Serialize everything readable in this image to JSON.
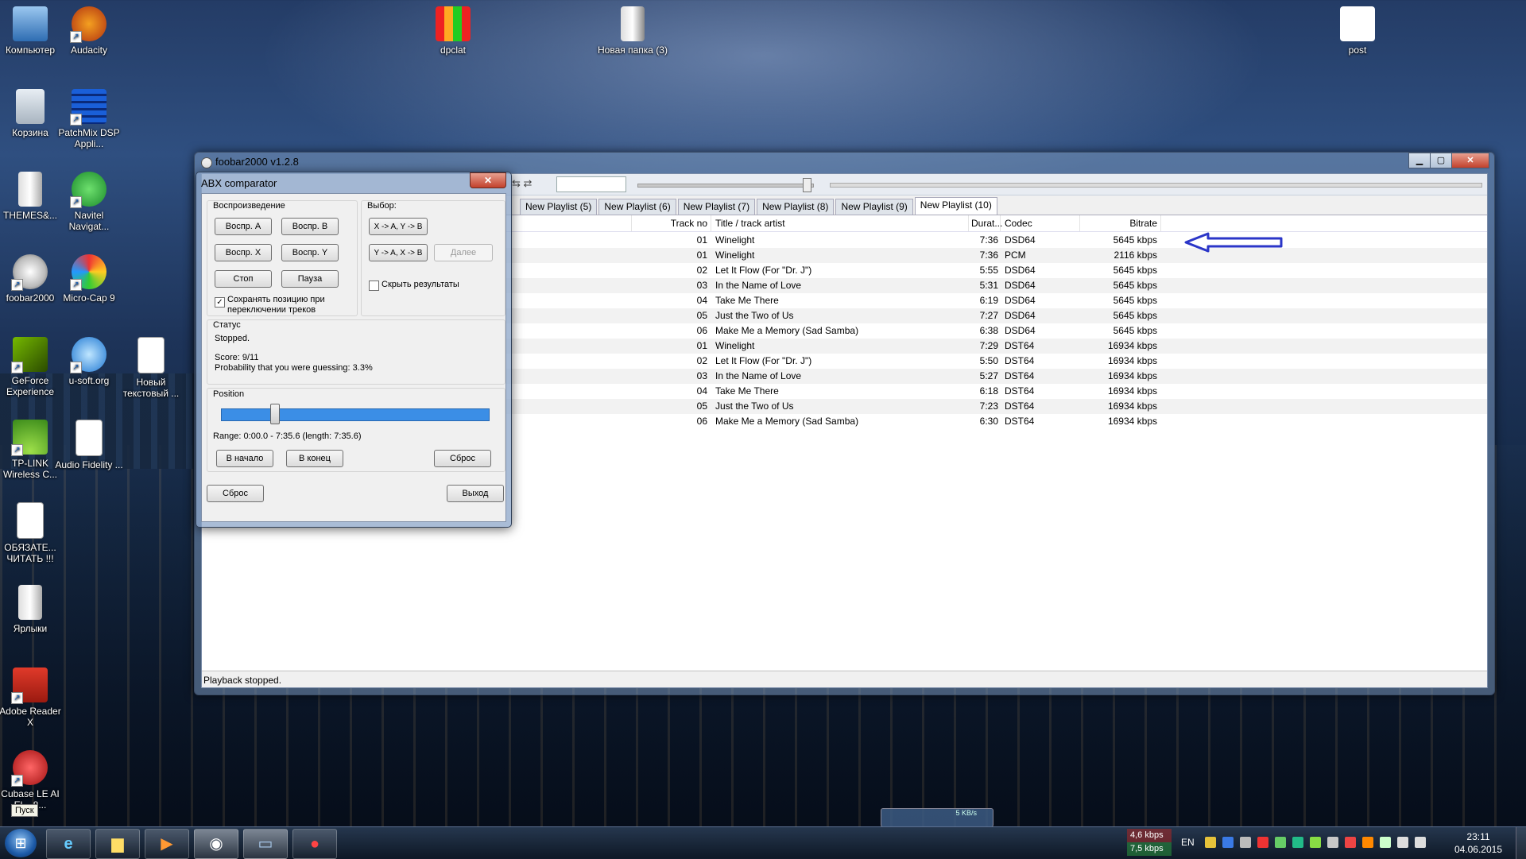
{
  "desktop": {
    "icons": [
      {
        "label": "Компьютер",
        "icon": "computer-icon"
      },
      {
        "label": "Audacity",
        "icon": "audacity-icon"
      },
      {
        "label": "Корзина",
        "icon": "recycle-bin-icon"
      },
      {
        "label": "PatchMix DSP Appli...",
        "icon": "patchmix-icon"
      },
      {
        "label": "THEMES&...",
        "icon": "folder-icon"
      },
      {
        "label": "Navitel Navigat...",
        "icon": "navitel-icon"
      },
      {
        "label": "foobar2000",
        "icon": "foobar-icon"
      },
      {
        "label": "Micro-Cap 9",
        "icon": "microcap-icon"
      },
      {
        "label": "GeForce Experience",
        "icon": "geforce-icon"
      },
      {
        "label": "u-soft.org",
        "icon": "ie-link-icon"
      },
      {
        "label": "Новый текстовый ...",
        "icon": "text-file-icon"
      },
      {
        "label": "TP-LINK Wireless C...",
        "icon": "wifi-icon"
      },
      {
        "label": "Audio Fidelity ...",
        "icon": "wav-file-icon"
      },
      {
        "label": "ОБЯЗАТЕ... ЧИТАТЬ !!!",
        "icon": "text-file-icon"
      },
      {
        "label": "Ярлыки",
        "icon": "folder-icon"
      },
      {
        "label": "Adobe Reader X",
        "icon": "adobe-reader-icon"
      },
      {
        "label": "Cubase LE AI El... 8...",
        "icon": "cubase-icon"
      },
      {
        "label": "dpclat",
        "icon": "dpclat-icon"
      },
      {
        "label": "Новая папка (3)",
        "icon": "folder-icon"
      },
      {
        "label": "post",
        "icon": "image-file-icon"
      }
    ]
  },
  "foobar": {
    "title": "foobar2000 v1.2.8",
    "tabs": [
      "New Playlist (5)",
      "New Playlist (6)",
      "New Playlist (7)",
      "New Playlist (8)",
      "New Playlist (9)",
      "New Playlist (10)"
    ],
    "columns": {
      "track_no": "Track no",
      "title": "Title / track artist",
      "duration": "Durat...",
      "codec": "Codec",
      "bitrate": "Bitrate"
    },
    "tracks": [
      {
        "no": "01",
        "title": "Winelight",
        "dur": "7:36",
        "codec": "DSD64",
        "bitrate": "5645 kbps"
      },
      {
        "no": "01",
        "title": "Winelight",
        "dur": "7:36",
        "codec": "PCM",
        "bitrate": "2116 kbps"
      },
      {
        "no": "02",
        "title": "Let It Flow (For \"Dr. J\")",
        "dur": "5:55",
        "codec": "DSD64",
        "bitrate": "5645 kbps"
      },
      {
        "no": "03",
        "title": "In the Name of Love",
        "dur": "5:31",
        "codec": "DSD64",
        "bitrate": "5645 kbps"
      },
      {
        "no": "04",
        "title": "Take Me There",
        "dur": "6:19",
        "codec": "DSD64",
        "bitrate": "5645 kbps"
      },
      {
        "no": "05",
        "title": "Just the Two of Us",
        "dur": "7:27",
        "codec": "DSD64",
        "bitrate": "5645 kbps"
      },
      {
        "no": "06",
        "title": "Make Me a Memory (Sad Samba)",
        "dur": "6:38",
        "codec": "DSD64",
        "bitrate": "5645 kbps"
      },
      {
        "no": "01",
        "title": "Winelight",
        "dur": "7:29",
        "codec": "DST64",
        "bitrate": "16934 kbps"
      },
      {
        "no": "02",
        "title": "Let It Flow (For \"Dr. J\")",
        "dur": "5:50",
        "codec": "DST64",
        "bitrate": "16934 kbps"
      },
      {
        "no": "03",
        "title": "In the Name of Love",
        "dur": "5:27",
        "codec": "DST64",
        "bitrate": "16934 kbps"
      },
      {
        "no": "04",
        "title": "Take Me There",
        "dur": "6:18",
        "codec": "DST64",
        "bitrate": "16934 kbps"
      },
      {
        "no": "05",
        "title": "Just the Two of Us",
        "dur": "7:23",
        "codec": "DST64",
        "bitrate": "16934 kbps"
      },
      {
        "no": "06",
        "title": "Make Me a Memory (Sad Samba)",
        "dur": "6:30",
        "codec": "DST64",
        "bitrate": "16934 kbps"
      }
    ],
    "status": "Playback stopped."
  },
  "abx": {
    "title": "ABX comparator",
    "close_label": "✕",
    "playback_label": "Воспроизведение",
    "choice_label": "Выбор:",
    "play_a": "Воспр. A",
    "play_b": "Воспр. B",
    "play_x": "Воспр. X",
    "play_y": "Воспр. Y",
    "stop": "Стоп",
    "pause": "Пауза",
    "choice_xa": "X -> A, Y -> B",
    "choice_ya": "Y -> A, X -> B",
    "next": "Далее",
    "keep_position": "Сохранять позицию при переключении треков",
    "keep_position_checked": true,
    "hide_results": "Скрыть результаты",
    "hide_results_checked": false,
    "status_label": "Статус",
    "status_text": "Stopped.",
    "score": "Score: 9/11",
    "probability": "Probability that you were guessing: 3.3%",
    "position_label": "Position",
    "position_fraction": 0.2,
    "range": "Range: 0:00.0 - 7:35.6 (length: 7:35.6)",
    "to_start": "В начало",
    "to_end": "В конец",
    "reset_range": "Сброс",
    "reset": "Сброс",
    "exit": "Выход"
  },
  "taskbar": {
    "start_tooltip": "Пуск",
    "net_up": "4,6 kbps",
    "net_down": "7,5 kbps",
    "lang": "EN",
    "time": "23:11",
    "date": "04.06.2015",
    "mini_speed": "5 KB/s"
  },
  "colors": {
    "arrow": "#2b36c8",
    "slider": "#3b8ee6"
  }
}
